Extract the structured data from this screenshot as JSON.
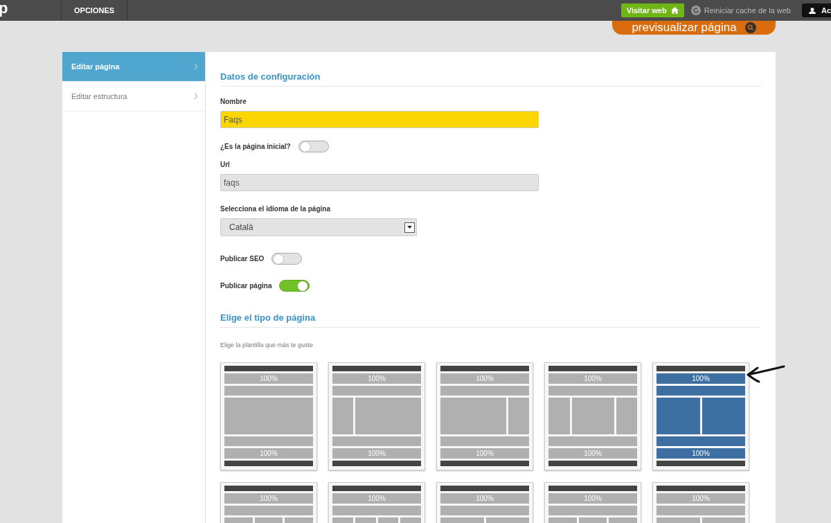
{
  "topbar": {
    "logo": "p",
    "menu": [
      {
        "label": "OPCIONES"
      }
    ],
    "visit_button": "Visitar web",
    "cache_link": "Reiniciar cache de la web",
    "user_button": "Ac"
  },
  "preview_button": "previsualizar página",
  "sidebar": {
    "items": [
      {
        "label": "Editar página",
        "selected": true
      },
      {
        "label": "Editar estructura",
        "selected": false
      }
    ]
  },
  "config": {
    "title": "Datos de configuración",
    "fields": [
      {
        "kind": "text",
        "label": "Nombre",
        "value": "Faqs",
        "highlighted": true
      },
      {
        "kind": "toggle",
        "label": "¿Es la página inicial?",
        "on": false
      },
      {
        "kind": "text",
        "label": "Url",
        "value": "faqs",
        "highlighted": false
      },
      {
        "kind": "select",
        "label": "Selecciona el idioma de la página",
        "value": "Català"
      },
      {
        "kind": "toggle",
        "label": "Publicar SEO",
        "on": false
      },
      {
        "kind": "toggle",
        "label": "Publicar página",
        "on": true
      }
    ]
  },
  "page_type": {
    "title": "Elige el tipo de página",
    "hint": "Elige la plantilla que más te guste",
    "templates": [
      {
        "kind": "full",
        "header_label": "100%",
        "footer_label": "100%",
        "selected": false
      },
      {
        "kind": "left-sidebar",
        "header_label": "100%",
        "footer_label": "100%",
        "selected": false
      },
      {
        "kind": "right-sidebar",
        "header_label": "100%",
        "footer_label": "100%",
        "selected": false
      },
      {
        "kind": "three-column",
        "header_label": "100%",
        "footer_label": "100%",
        "selected": false
      },
      {
        "kind": "two-column",
        "header_label": "100%",
        "footer_label": "100%",
        "selected": true
      },
      {
        "kind": "three-column-equal",
        "header_label": "100%",
        "selected": false
      },
      {
        "kind": "four-column",
        "header_label": "100%",
        "selected": false
      },
      {
        "kind": "two-column",
        "header_label": "100%",
        "selected": false
      },
      {
        "kind": "three-column-equal",
        "header_label": "100%",
        "selected": false
      },
      {
        "kind": "two-column",
        "header_label": "100%",
        "selected": false
      }
    ]
  }
}
